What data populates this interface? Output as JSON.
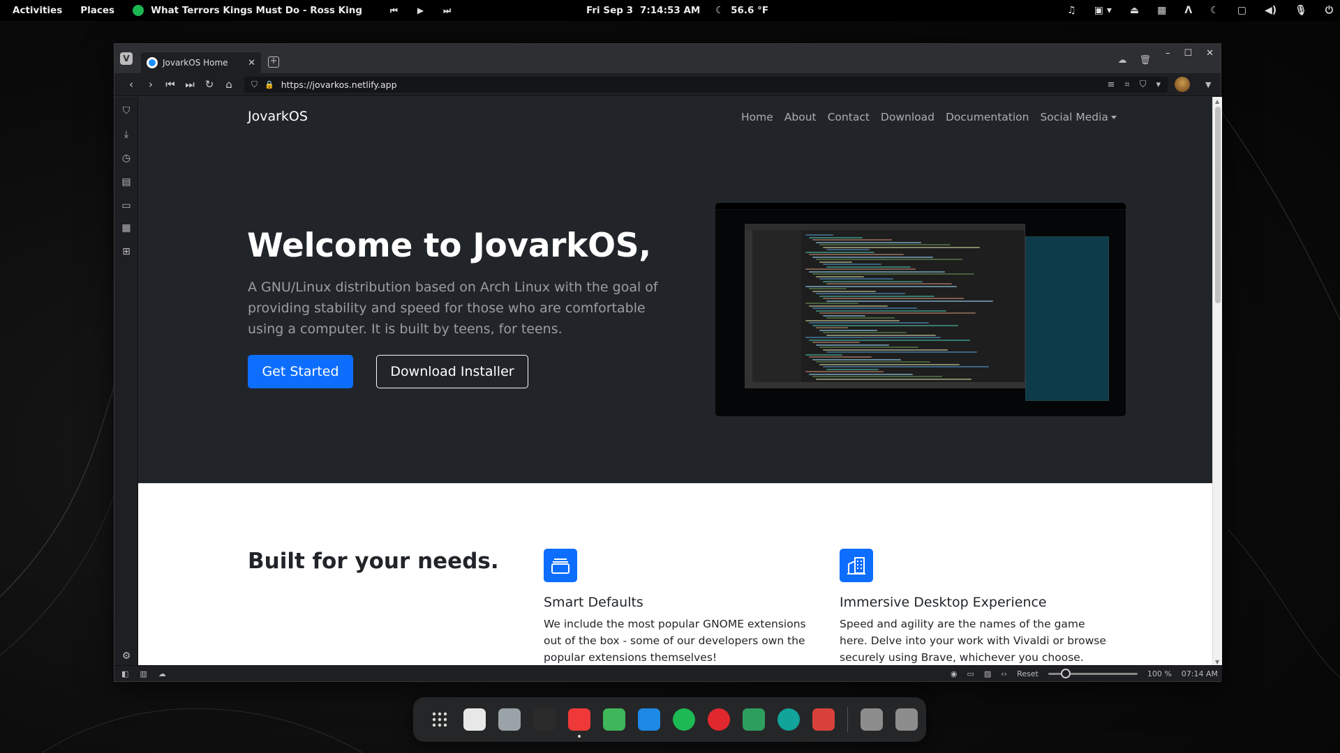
{
  "topbar": {
    "activities": "Activities",
    "places": "Places",
    "now_playing": "What Terrors Kings Must Do - Ross King",
    "prev": "⏮",
    "play": "▶",
    "next": "⏭",
    "date": "Fri Sep 3",
    "time": "7:14:53 AM",
    "weather_icon": "☾",
    "temperature": "56.6 °F",
    "tray_icons": [
      "music-note-icon",
      "clipboard-icon",
      "eject-icon",
      "workspace-icon",
      "vivaldi-tray-icon",
      "night-light-icon",
      "screen-icon",
      "volume-icon",
      "mic-icon",
      "power-icon"
    ]
  },
  "browser": {
    "tab_title": "JovarkOS Home",
    "tab_close": "✕",
    "new_tab": "+",
    "url": "https://jovarkos.netlify.app",
    "window_controls": {
      "minimize": "–",
      "maximize": "☐",
      "close": "✕"
    }
  },
  "site": {
    "brand": "JovarkOS",
    "nav": [
      "Home",
      "About",
      "Contact",
      "Download",
      "Documentation",
      "Social Media"
    ],
    "hero": {
      "title": "Welcome to JovarkOS,",
      "lead": "A GNU/Linux distribution based on Arch Linux with the goal of providing stability and speed for those who are comfortable using a computer. It is built by teens, for teens.",
      "primary_button": "Get Started",
      "secondary_button": "Download Installer"
    },
    "features": {
      "heading": "Built for your needs.",
      "items": [
        {
          "icon": "collection-icon",
          "title": "Smart Defaults",
          "desc": "We include the most popular GNOME extensions out of the box - some of our developers own the popular extensions themselves!"
        },
        {
          "icon": "building-icon",
          "title": "Immersive Desktop Experience",
          "desc": "Speed and agility are the names of the game here. Delve into your work with Vivaldi or browse securely using Brave, whichever you choose."
        }
      ]
    }
  },
  "statusbar": {
    "reset": "Reset",
    "zoom": "100 %",
    "clock": "07:14 AM"
  },
  "dock": {
    "apps": [
      {
        "name": "app-grid",
        "color": "#252627"
      },
      {
        "name": "calendar",
        "color": "#e8e8e8"
      },
      {
        "name": "files-archive",
        "color": "#9aa3a8"
      },
      {
        "name": "terminal",
        "color": "#2b2b2b"
      },
      {
        "name": "vivaldi",
        "color": "#ef3939"
      },
      {
        "name": "file-manager",
        "color": "#3fb65a"
      },
      {
        "name": "vscode",
        "color": "#1e88e5"
      },
      {
        "name": "spotify",
        "color": "#1db954"
      },
      {
        "name": "creative-cloud",
        "color": "#e0282e"
      },
      {
        "name": "gnome-tweaks",
        "color": "#2e9e5e"
      },
      {
        "name": "aperture",
        "color": "#12a39a"
      },
      {
        "name": "screenshot-tool",
        "color": "#d8413a"
      },
      {
        "name": "image-viewer",
        "color": "#8d8d8d"
      },
      {
        "name": "trash",
        "color": "#8d8d8d"
      }
    ]
  }
}
